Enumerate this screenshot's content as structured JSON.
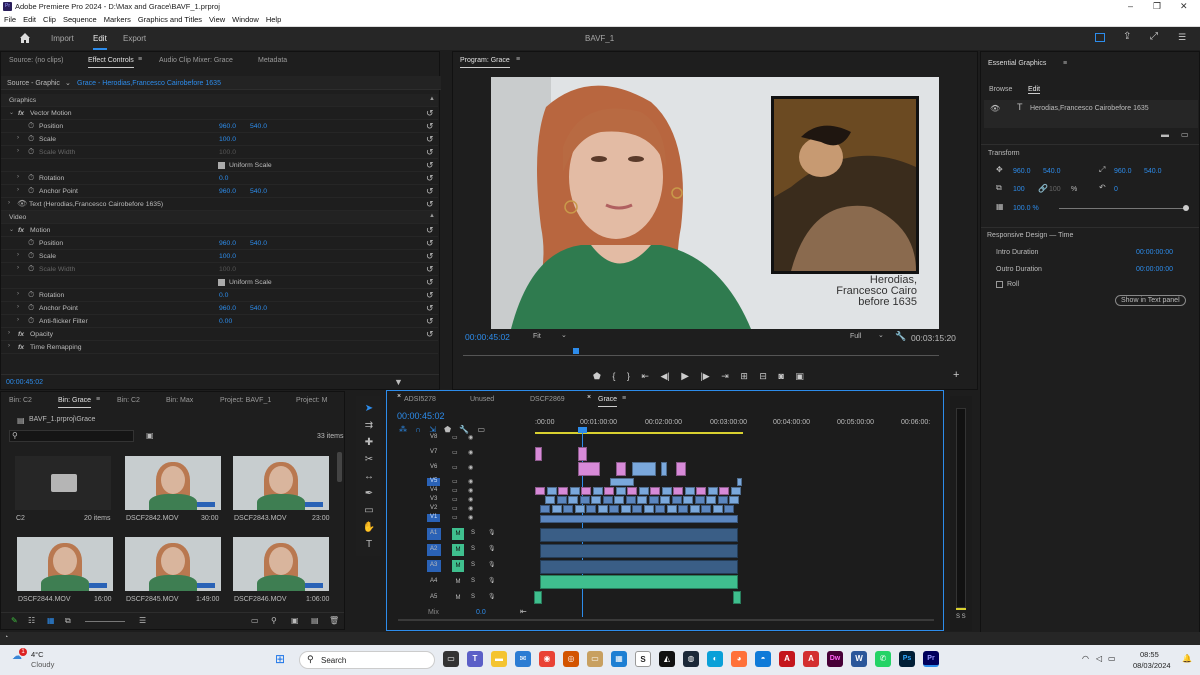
{
  "window": {
    "title": "Adobe Premiere Pro 2024 - D:\\Max and Grace\\BAVF_1.prproj",
    "app_badge": "Pr",
    "minimize": "–",
    "maximize": "❐",
    "close": "✕"
  },
  "menu": [
    "File",
    "Edit",
    "Clip",
    "Sequence",
    "Markers",
    "Graphics and Titles",
    "View",
    "Window",
    "Help"
  ],
  "workspace": {
    "import": "Import",
    "edit": "Edit",
    "export": "Export",
    "project_title": "BAVF_1"
  },
  "effect_controls": {
    "tabs": [
      "Source: (no clips)",
      "Effect Controls",
      "Audio Clip Mixer: Grace",
      "Metadata"
    ],
    "source_label": "Source - Graphic",
    "clip_label": "Grace - Herodias,Francesco Cairobefore 1635",
    "section_graphics": "Graphics",
    "vector_motion": "Vector Motion",
    "uniform_scale": "Uniform Scale",
    "text_layer": "Text (Herodias,Francesco Cairobefore 1635)",
    "section_video": "Video",
    "motion": "Motion",
    "rows1": [
      {
        "label": "Position",
        "v1": "960.0",
        "v2": "540.0"
      },
      {
        "label": "Scale",
        "v1": "100.0",
        "v2": ""
      },
      {
        "label": "Scale Width",
        "v1": "",
        "v2": ""
      },
      {
        "label": "Rotation",
        "v1": "0.0",
        "v2": ""
      },
      {
        "label": "Anchor Point",
        "v1": "960.0",
        "v2": "540.0"
      }
    ],
    "rows2": [
      {
        "label": "Position",
        "v1": "960.0",
        "v2": "540.0"
      },
      {
        "label": "Scale",
        "v1": "100.0",
        "v2": ""
      },
      {
        "label": "Scale Width",
        "v1": "",
        "v2": ""
      },
      {
        "label": "Rotation",
        "v1": "0.0",
        "v2": ""
      },
      {
        "label": "Anchor Point",
        "v1": "960.0",
        "v2": "540.0"
      },
      {
        "label": "Anti-flicker Filter",
        "v1": "0.00",
        "v2": ""
      }
    ],
    "disabled_value": "100.0",
    "opacity": "Opacity",
    "time_remapping": "Time Remapping",
    "timecode": "00:00:45:02"
  },
  "program": {
    "tab": "Program: Grace",
    "timecode": "00:00:45:02",
    "fit": "Fit",
    "quality": "Full",
    "duration": "00:03:15:20",
    "caption": [
      "Herodias,",
      "Francesco Cairo",
      "before 1635"
    ]
  },
  "essential_graphics": {
    "title": "Essential Graphics",
    "tabs": [
      "Browse",
      "Edit"
    ],
    "layer": "Herodias,Francesco Cairobefore 1635",
    "transform": "Transform",
    "pos_x": "960.0",
    "pos_y": "540.0",
    "anchor_x": "960.0",
    "anchor_y": "540.0",
    "scale": "100",
    "scale2": "100",
    "percent": "%",
    "rotation": "0",
    "opacity": "100.0 %",
    "responsive": "Responsive Design — Time",
    "intro": "Intro Duration",
    "intro_val": "00:00:00:00",
    "outro": "Outro Duration",
    "outro_val": "00:00:00:00",
    "roll": "Roll",
    "show_text_panel": "Show in Text panel"
  },
  "project": {
    "tabs": [
      "Bin: C2",
      "Bin: Grace",
      "Bin: C2",
      "Bin: Max",
      "Project: BAVF_1",
      "Project: M"
    ],
    "path": "BAVF_1.prproj\\Grace",
    "count": "33 items",
    "items": [
      {
        "name": "C2",
        "meta": "20 items"
      },
      {
        "name": "DSCF2842.MOV",
        "meta": "30:00"
      },
      {
        "name": "DSCF2843.MOV",
        "meta": "23:00"
      },
      {
        "name": "DSCF2844.MOV",
        "meta": "16:00"
      },
      {
        "name": "DSCF2845.MOV",
        "meta": "1:49:00"
      },
      {
        "name": "DSCF2846.MOV",
        "meta": "1:06:00"
      }
    ]
  },
  "timeline": {
    "tabs": [
      "ADSI5278",
      "Unused",
      "DSCF2869",
      "Grace"
    ],
    "timecode": "00:00:45:02",
    "ruler": [
      ":00:00",
      "00:01:00:00",
      "00:02:00:00",
      "00:03:00:00",
      "00:04:00:00",
      "00:05:00:00",
      "00:06:00:"
    ],
    "video_tracks": [
      "V8",
      "V7",
      "V6",
      "V5",
      "V4",
      "V3",
      "V2",
      "V1"
    ],
    "audio_tracks": [
      "A1",
      "A2",
      "A3",
      "A4",
      "A5"
    ],
    "mix": "Mix",
    "mix_val": "0.0",
    "mute": "M",
    "solo": "S"
  },
  "meter": {
    "labels": "S S"
  },
  "taskbar": {
    "temp": "4°C",
    "weather": "Cloudy",
    "notify": "1",
    "search": "Search",
    "time": "08:55",
    "date": "08/03/2024",
    "apps": [
      "S",
      "Ps",
      "Pr",
      "Dw"
    ]
  }
}
